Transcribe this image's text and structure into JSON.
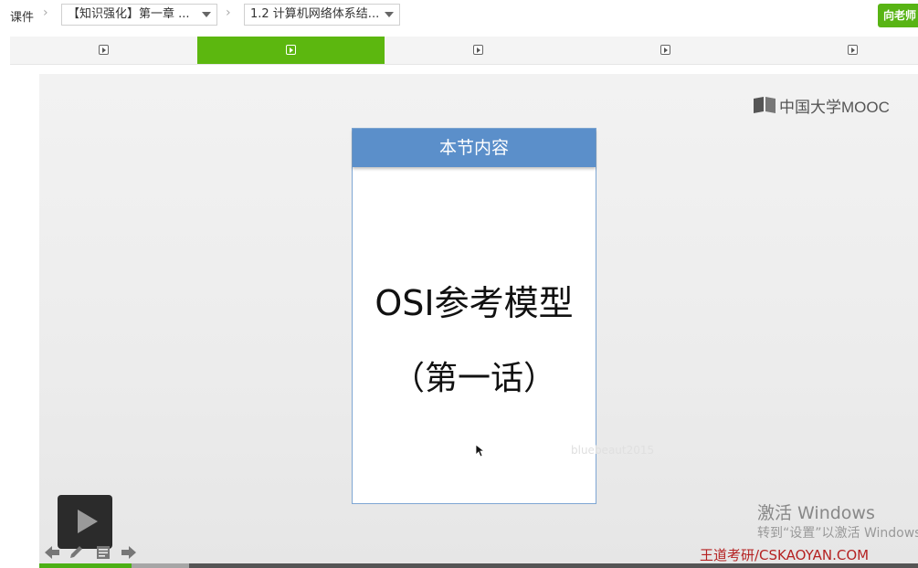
{
  "breadcrumb": {
    "root": "课件",
    "chapter_select": "【知识强化】第一章 ...",
    "lesson_select": "1.2 计算机网络体系结..."
  },
  "ask_teacher_label": "向老师",
  "tabs": {
    "count": 5,
    "active_index": 1,
    "icons": [
      "video-icon",
      "video-icon",
      "video-icon",
      "video-icon",
      "video-icon"
    ]
  },
  "video": {
    "logo_text": "中国大学MOOC",
    "slide": {
      "header": "本节内容",
      "title": "OSI参考模型",
      "subtitle": "（第一话）"
    },
    "faint_watermark": "bluebeaut2015",
    "windows_notice": {
      "title": "激活 Windows",
      "subtitle": "转到“设置”以激活 Windows"
    },
    "site_watermark": "王道考研/CSKAOYAN.COM",
    "progress": {
      "played": 0.105,
      "buffered": 0.17
    }
  },
  "colors": {
    "accent_green": "#5cb70f",
    "slide_header_blue": "#5b8fca",
    "watermark_red": "#b52222"
  }
}
